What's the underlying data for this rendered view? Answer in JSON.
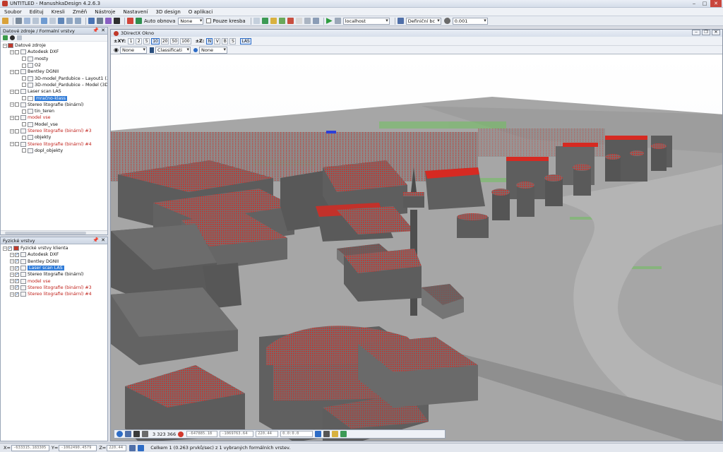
{
  "window": {
    "title": "UNTITLED - ManushkaDesign 4.2.6.3"
  },
  "menu": [
    "Soubor",
    "Edituj",
    "Kresli",
    "Změň",
    "Nástroje",
    "Nastavení",
    "3D design",
    "O aplikaci"
  ],
  "toolbar": {
    "auto_label": "Auto obnova",
    "auto_value": "None",
    "only_draw_label": "Pouze kresba",
    "server": "localhost",
    "definition": "Definiční bc",
    "precision": "0.001"
  },
  "panel_top": {
    "title": "Datové zdroje / Formalní vrstvy",
    "tree": [
      {
        "label": "Datové zdroje",
        "level": 0,
        "color": "normal"
      },
      {
        "label": "Autodesk DXF",
        "level": 1,
        "color": "normal"
      },
      {
        "label": "mosty",
        "level": 2,
        "color": "normal"
      },
      {
        "label": "O2",
        "level": 2,
        "color": "normal"
      },
      {
        "label": "Bentley DGNII",
        "level": 1,
        "color": "normal"
      },
      {
        "label": "3D-model_Pardubice – Layout1 (3D",
        "level": 2,
        "color": "normal"
      },
      {
        "label": "3D-model_Pardubice – Model (3D)",
        "level": 2,
        "color": "normal"
      },
      {
        "label": "Laser scan LAS",
        "level": 1,
        "color": "normal"
      },
      {
        "label": "mračno-klass",
        "level": 2,
        "color": "selected"
      },
      {
        "label": "Stereo litografie (binární)",
        "level": 1,
        "color": "normal"
      },
      {
        "label": "tin_teren",
        "level": 2,
        "color": "normal"
      },
      {
        "label": "model vse",
        "level": 1,
        "color": "red"
      },
      {
        "label": "Model_vse",
        "level": 2,
        "color": "normal"
      },
      {
        "label": "Stereo litografie (binární) #3",
        "level": 1,
        "color": "red"
      },
      {
        "label": "objekty",
        "level": 2,
        "color": "normal"
      },
      {
        "label": "Stereo litografie (binární) #4",
        "level": 1,
        "color": "red"
      },
      {
        "label": "dopl_objekty",
        "level": 2,
        "color": "normal"
      }
    ]
  },
  "panel_bottom": {
    "title": "Fyzické vrstvy",
    "tree": [
      {
        "label": "Fyzické vrstvy klienta",
        "level": 0,
        "color": "normal"
      },
      {
        "label": "Autodesk DXF",
        "level": 1,
        "color": "normal"
      },
      {
        "label": "Bentley DGNII",
        "level": 1,
        "color": "normal"
      },
      {
        "label": "Laser scan LAS",
        "level": 1,
        "color": "selected"
      },
      {
        "label": "Stereo litografie (binární)",
        "level": 1,
        "color": "normal"
      },
      {
        "label": "model vse",
        "level": 1,
        "color": "red"
      },
      {
        "label": "Stereo litografie (binární) #3",
        "level": 1,
        "color": "red"
      },
      {
        "label": "Stereo litografie (binární) #4",
        "level": 1,
        "color": "red"
      }
    ]
  },
  "viewport": {
    "title": "3DirectX Okno",
    "xy_label": "±XY:",
    "xy_steps": [
      "1",
      "2",
      "5",
      "10",
      "20",
      "50",
      "100"
    ],
    "xy_active": "10",
    "z_label": "±Z:",
    "z_buttons": [
      "N",
      "V",
      "B",
      "S"
    ],
    "las_label": "LAS",
    "eye_value": "None",
    "class_value": "Classificati",
    "color_value": "None",
    "point_count": "3 323 366",
    "coord_x": "-647885.18",
    "coord_y": "-1069763.64",
    "coord_z": "220.44",
    "coord_angle": "0.0:0.0"
  },
  "statusbar": {
    "x_label": "X=",
    "x_value": "-633315.183305",
    "y_label": "Y=",
    "y_value": "-1062490.4579",
    "z_label": "Z=",
    "z_value": "220.44",
    "message": "Celkem 1 (0.263 prvků/sec) z 1 vybraných formálních vrstev."
  }
}
